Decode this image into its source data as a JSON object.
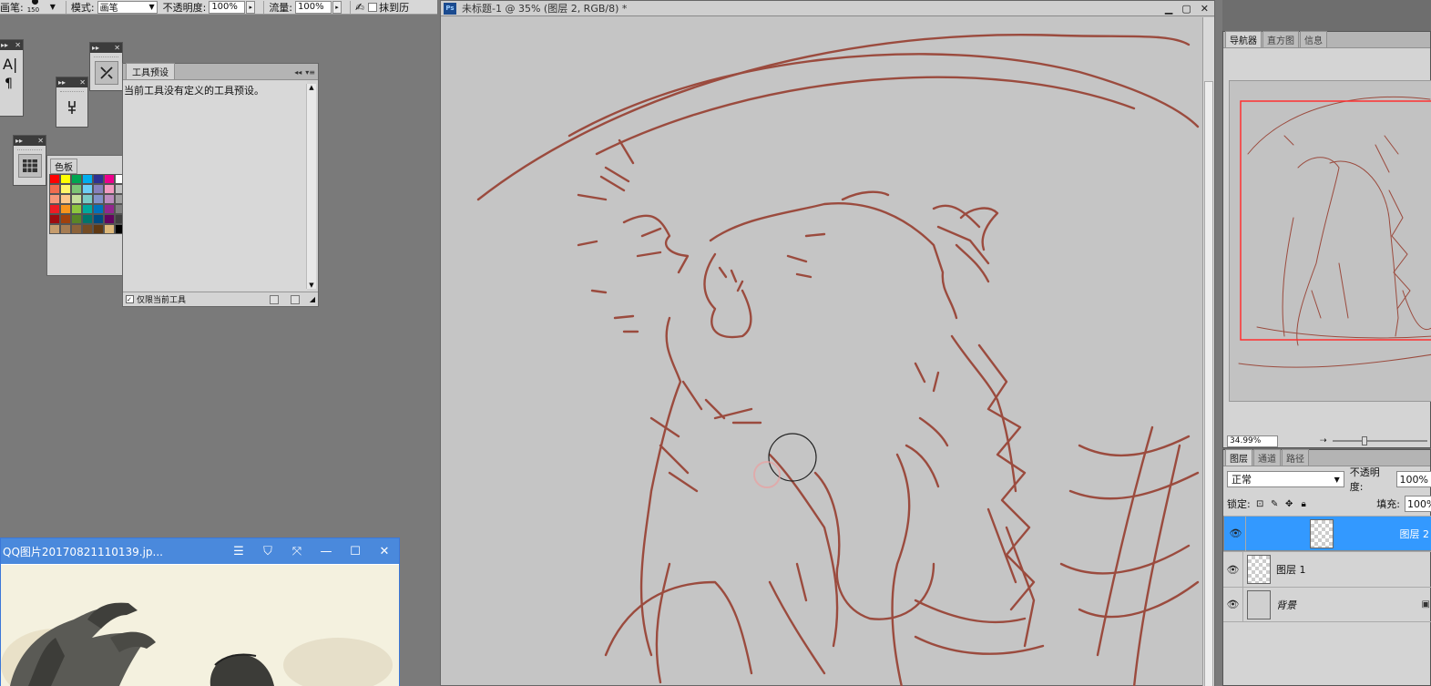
{
  "options_bar": {
    "brush_label": "画笔:",
    "brush_size": "150",
    "mode_label": "模式:",
    "mode_value": "画笔",
    "opacity_label": "不透明度:",
    "opacity_value": "100%",
    "flow_label": "流量:",
    "flow_value": "100%",
    "erase_label": "抹到历"
  },
  "tool_presets": {
    "tab": "工具预设",
    "empty_message": "当前工具没有定义的工具预设。",
    "footer_checkbox": "仅限当前工具"
  },
  "swatches": {
    "tab": "色板",
    "colors": [
      "#ff0000",
      "#ffff00",
      "#00a651",
      "#00aeef",
      "#2e3192",
      "#ec008c",
      "#ffffff",
      "#f26c4f",
      "#fff568",
      "#7cc576",
      "#6dcff6",
      "#8781bd",
      "#f49ac1",
      "#c0c0c0",
      "#f7977a",
      "#fdc68a",
      "#c4df9b",
      "#7accc8",
      "#8393ca",
      "#bd8cbf",
      "#a0a0a0",
      "#ed1c24",
      "#f7941d",
      "#8dc63f",
      "#00a99d",
      "#0072bc",
      "#92278f",
      "#808080",
      "#9e0b0f",
      "#a0410d",
      "#598527",
      "#00746b",
      "#004a80",
      "#630460",
      "#404040",
      "#c69c6d",
      "#a67c52",
      "#8c6239",
      "#754c24",
      "#603913",
      "#ddb87a",
      "#000000"
    ]
  },
  "document": {
    "title": "未标题-1 @ 35% (图层 2, RGB/8) *",
    "ps_badge": "Ps",
    "stroke_color": "#9b4b3e"
  },
  "navigator": {
    "tabs": [
      "导航器",
      "直方图",
      "信息"
    ],
    "zoom": "34.99%"
  },
  "layers_panel": {
    "tabs": [
      "图层",
      "通道",
      "路径"
    ],
    "blend_mode": "正常",
    "opacity_label": "不透明度:",
    "opacity_value": "100%",
    "lock_label": "锁定:",
    "fill_label": "填充:",
    "fill_value": "100%",
    "layers": [
      {
        "name": "图层 2",
        "selected": true
      },
      {
        "name": "图层 1",
        "selected": false
      },
      {
        "name": "背景",
        "selected": false
      }
    ],
    "selection_color": "#3399ff"
  },
  "qq_viewer": {
    "title": "QQ图片20170821110139.jp..."
  }
}
